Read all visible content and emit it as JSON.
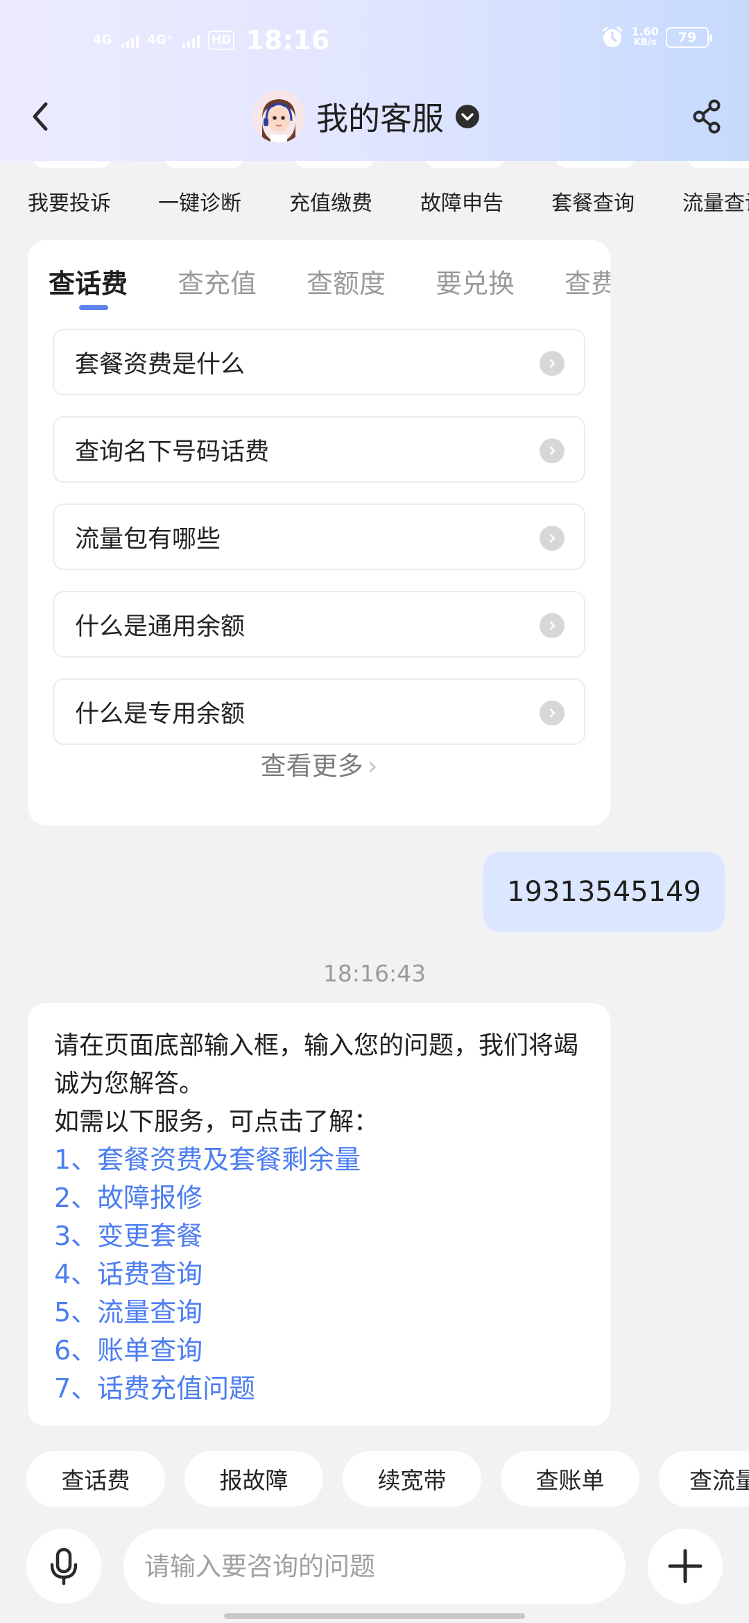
{
  "status_bar": {
    "network1": "4G",
    "network2": "4G⁺",
    "hd_label": "HD",
    "time": "18:16",
    "speed_value": "1.60",
    "speed_unit": "KB/s",
    "battery": "79"
  },
  "header": {
    "title": "我的客服"
  },
  "services": [
    "我要投诉",
    "一键诊断",
    "充值缴费",
    "故障申告",
    "套餐查询",
    "流量查询"
  ],
  "tabs": [
    "查话费",
    "查充值",
    "查额度",
    "要兑换",
    "查费用"
  ],
  "questions": [
    "套餐资费是什么",
    "查询名下号码话费",
    "流量包有哪些",
    "什么是通用余额",
    "什么是专用余额"
  ],
  "more_label": "查看更多",
  "user_message": "19313545149",
  "timestamp": "18:16:43",
  "reply": {
    "line1": "请在页面底部输入框，输入您的问题，我们将竭诚为您解答。",
    "line2": "如需以下服务，可点击了解：",
    "links": [
      "1、套餐资费及套餐剩余量",
      "2、故障报修",
      "3、变更套餐",
      "4、话费查询",
      "5、流量查询",
      "6、账单查询",
      "7、话费充值问题"
    ]
  },
  "chips": [
    "查话费",
    "报故障",
    "续宽带",
    "查账单",
    "查流量"
  ],
  "input": {
    "placeholder": "请输入要咨询的问题",
    "value": ""
  },
  "colors": {
    "accent": "#4c7df0",
    "user_bubble": "#dbe6ff",
    "background": "#f2f2f4"
  }
}
